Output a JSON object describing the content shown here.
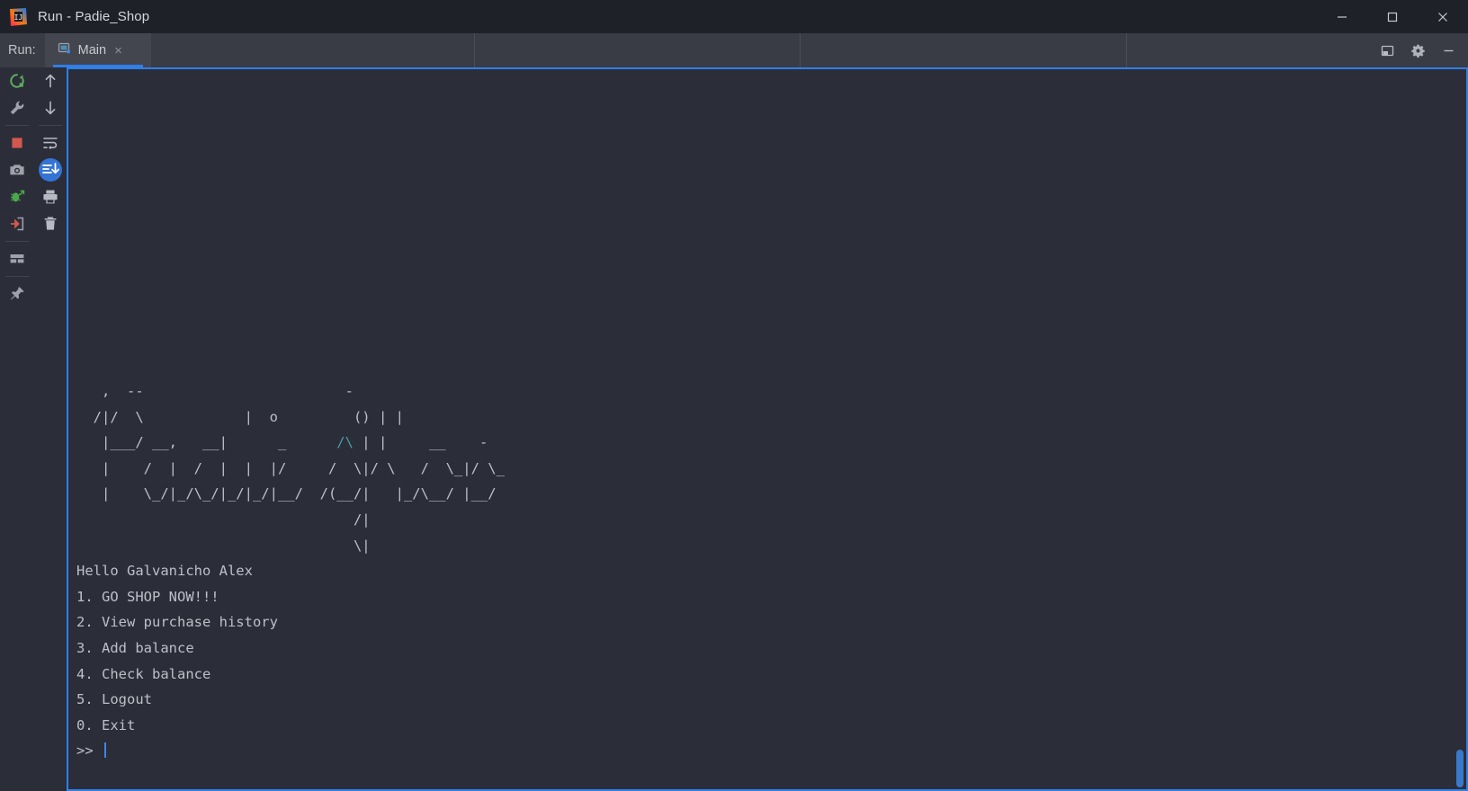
{
  "window": {
    "title": "Run - Padie_Shop",
    "app_icon": "intellij-idea-logo",
    "controls": {
      "minimize": "minimize-icon",
      "maximize": "maximize-icon",
      "close": "close-icon"
    }
  },
  "tabrow": {
    "run_label": "Run:",
    "tabs": [
      {
        "label": "Main",
        "icon": "run-configuration-icon",
        "close": "×",
        "active": true
      }
    ],
    "right_buttons": [
      {
        "name": "hide-window-icon"
      },
      {
        "name": "settings-gear-icon"
      },
      {
        "name": "minimize-tool-window-icon"
      }
    ]
  },
  "toolbar": {
    "column_left": [
      {
        "name": "rerun-icon",
        "tooltip": "Rerun",
        "color": "#5fad5f"
      },
      {
        "name": "wrench-icon",
        "tooltip": "Modify Run Configuration",
        "color": "#9ea2ab"
      },
      {
        "name": "stop-icon",
        "tooltip": "Stop",
        "color": "#d2584f"
      },
      {
        "name": "camera-icon",
        "tooltip": "Capture Memory Snapshot",
        "color": "#9ea2ab"
      },
      {
        "name": "restart-debug-icon",
        "tooltip": "Attach Debugger",
        "color": "#4aa84a"
      },
      {
        "name": "attach-process-icon",
        "tooltip": "Attach To Process",
        "color": "#d2584f"
      },
      {
        "name": "layout-icon",
        "tooltip": "Layout Settings",
        "color": "#9ea2ab"
      },
      {
        "name": "pin-icon",
        "tooltip": "Pin Tab",
        "color": "#9ea2ab"
      }
    ],
    "column_right": [
      {
        "name": "arrow-up-icon",
        "tooltip": "Up the Stack Trace",
        "color": "#b6bac2"
      },
      {
        "name": "arrow-down-icon",
        "tooltip": "Down the Stack Trace",
        "color": "#b6bac2"
      },
      {
        "name": "soft-wrap-icon",
        "tooltip": "Soft-Wrap",
        "color": "#b6bac2"
      },
      {
        "name": "scroll-to-end-icon",
        "tooltip": "Scroll to the end",
        "color": "#ffffff",
        "active": true
      },
      {
        "name": "print-icon",
        "tooltip": "Print",
        "color": "#b6bac2"
      },
      {
        "name": "clear-all-icon",
        "tooltip": "Clear All",
        "color": "#b6bac2"
      }
    ]
  },
  "console": {
    "ascii_art": [
      "   ,  --                        -",
      "  /|/  \\            |  o         () | |",
      "   |___/ __,   __|      _      /\\ | |     __    -",
      "   |    /  |  /  |  |  |/     /  \\|/ \\   /  \\_|/ \\_",
      "   |    \\_/|_/\\_/|_/|_/|__/  /(__/|   |_/\\__/ |__/",
      "                                 /|",
      "                                 \\|"
    ],
    "greeting": "Hello Galvanicho Alex",
    "menu": [
      "1. GO SHOP NOW!!!",
      "2. View purchase history",
      "3. Add balance",
      "4. Check balance",
      "5. Logout",
      "0. Exit"
    ],
    "prompt": ">> ",
    "input_value": "",
    "accent_color": "#2f7fe8",
    "text_color": "#bcc0c8",
    "triangle_color": "#4c9aa8",
    "background": "#2b2d38"
  }
}
